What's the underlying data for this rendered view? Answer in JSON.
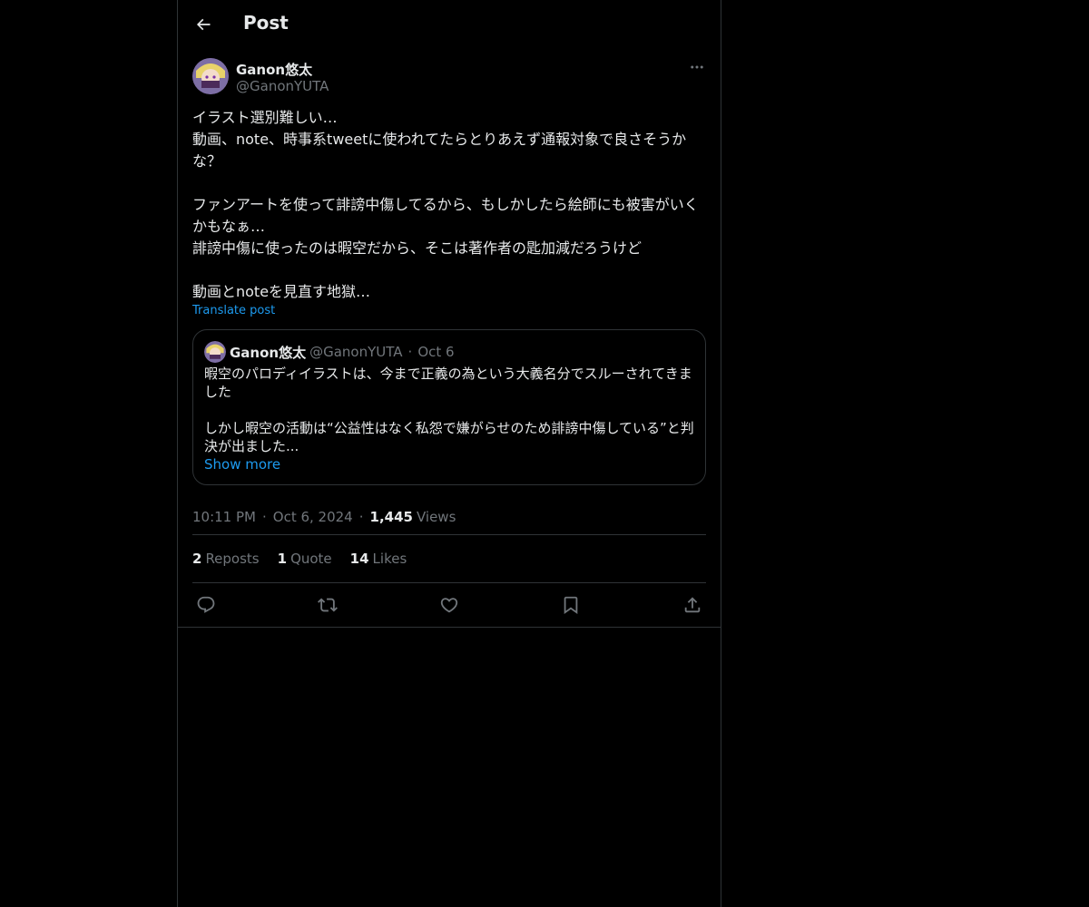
{
  "header": {
    "title": "Post",
    "back_icon": "arrow-left-icon"
  },
  "post": {
    "author": {
      "name": "Ganon悠太",
      "handle": "@GanonYUTA",
      "avatar_icon": "avatar-image"
    },
    "more_icon": "more-horizontal-icon",
    "text": "イラスト選別難しい…\n動画、note、時事系tweetに使われてたらとりあえず通報対象で良さそうかな？\n\nファンアートを使って誹謗中傷してるから、もしかしたら絵師にも被害がいくかもなぁ…\n誹謗中傷に使ったのは暇空だから、そこは著作者の匙加減だろうけど\n\n動画とnoteを見直す地獄…",
    "translate_label": "Translate post",
    "quote": {
      "name": "Ganon悠太",
      "handle": "@GanonYUTA",
      "dot": "·",
      "date": "Oct 6",
      "text": "暇空のパロディイラストは、今まで正義の為という大義名分でスルーされてきました\n\nしかし暇空の活動は“公益性はなく私怨で嫌がらせのため誹謗中傷している”と判決が出ました...",
      "show_more_label": "Show more"
    },
    "meta": {
      "time": "10:11 PM",
      "sep": "·",
      "date": "Oct 6, 2024",
      "views_count": "1,445",
      "views_label": "Views"
    },
    "stats": {
      "reposts_count": "2",
      "reposts_label": "Reposts",
      "quotes_count": "1",
      "quotes_label": "Quote",
      "likes_count": "14",
      "likes_label": "Likes"
    },
    "actions": [
      "reply-icon",
      "repost-icon",
      "like-icon",
      "bookmark-icon",
      "share-icon"
    ]
  },
  "colors": {
    "background": "#000000",
    "text": "#e7e9ea",
    "secondary": "#71767b",
    "accent": "#1d9bf0",
    "border": "#2f3336"
  }
}
